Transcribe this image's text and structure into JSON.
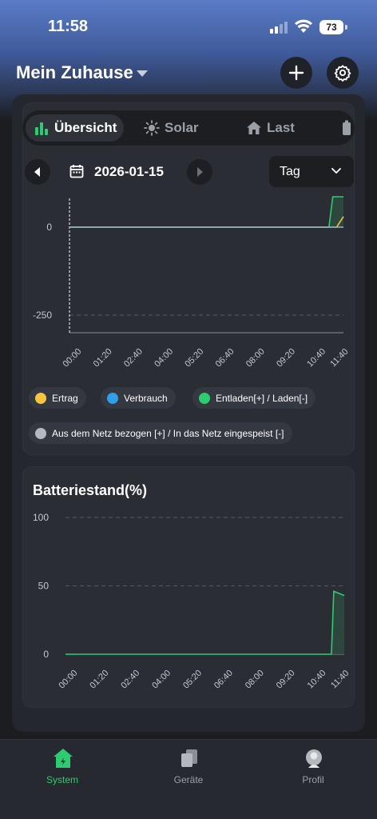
{
  "status_bar": {
    "time": "11:58",
    "battery": "73"
  },
  "header": {
    "title": "Mein Zuhause"
  },
  "tabs": [
    {
      "label": "Übersicht",
      "icon": "bar-chart-icon",
      "active": true
    },
    {
      "label": "Solar",
      "icon": "sun-icon"
    },
    {
      "label": "Last",
      "icon": "house-icon"
    }
  ],
  "date_nav": {
    "date": "2026-01-15",
    "period": "Tag"
  },
  "legend": [
    {
      "label": "Ertrag",
      "color": "#f5c542"
    },
    {
      "label": "Verbrauch",
      "color": "#2f9fe8"
    },
    {
      "label": "Entladen[+] / Laden[-]",
      "color": "#2ecc71"
    },
    {
      "label": "Aus dem Netz bezogen [+] / In das Netz eingespeist [-]",
      "color": "#b5b8bf"
    }
  ],
  "battery_chart": {
    "title": "Batteriestand(%)"
  },
  "chart_data": [
    {
      "type": "area",
      "title": "",
      "y_ticks": [
        "0",
        "-250"
      ],
      "x_ticks": [
        "00:00",
        "01:20",
        "02:40",
        "04:00",
        "05:20",
        "06:40",
        "08:00",
        "09:20",
        "10:40",
        "11:40"
      ],
      "series": [
        {
          "name": "Entladen[+] / Laden[-]",
          "color": "#2ecc71",
          "x": [
            "00:00",
            "11:20",
            "11:30",
            "11:58"
          ],
          "y": [
            0,
            0,
            160,
            160
          ]
        },
        {
          "name": "Ertrag",
          "color": "#f5c542",
          "x": [
            "00:00",
            "11:40",
            "11:58"
          ],
          "y": [
            0,
            0,
            30
          ]
        },
        {
          "name": "Verbrauch",
          "color": "#2f9fe8",
          "x": [
            "00:00",
            "11:58"
          ],
          "y": [
            0,
            0
          ]
        }
      ]
    },
    {
      "type": "area",
      "title": "Batteriestand(%)",
      "ylim": [
        0,
        100
      ],
      "y_ticks": [
        "100",
        "50",
        "0"
      ],
      "x_ticks": [
        "00:00",
        "01:20",
        "02:40",
        "04:00",
        "05:20",
        "06:40",
        "08:00",
        "09:20",
        "10:40",
        "11:40"
      ],
      "series": [
        {
          "color": "#2ecc71",
          "x": [
            "00:00",
            "11:25",
            "11:31",
            "11:58"
          ],
          "y": [
            0,
            0,
            46,
            43
          ]
        }
      ]
    }
  ],
  "tabbar": [
    {
      "label": "System",
      "icon": "house-icon",
      "active": true
    },
    {
      "label": "Geräte",
      "icon": "devices-icon"
    },
    {
      "label": "Profil",
      "icon": "profile-icon"
    }
  ]
}
